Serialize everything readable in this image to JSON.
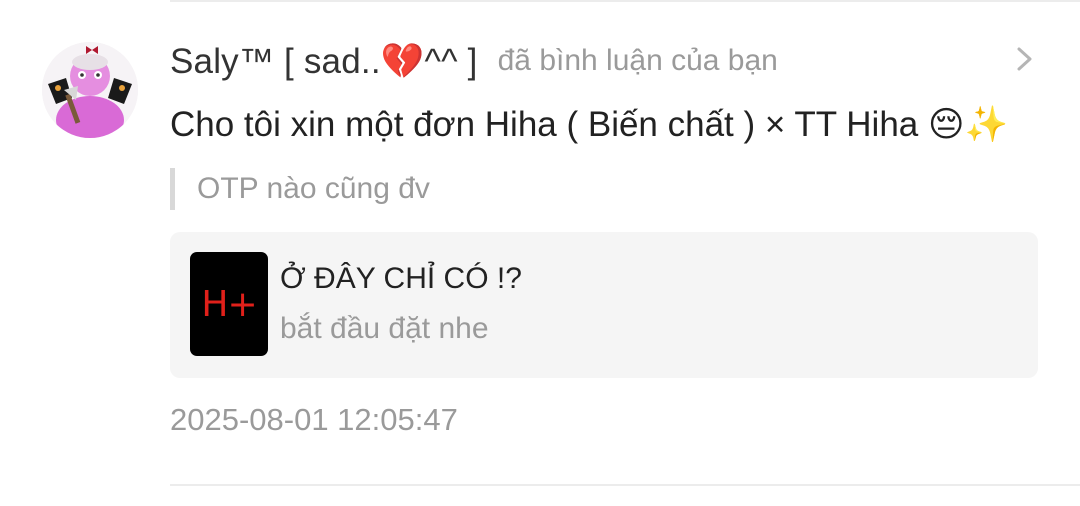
{
  "notification": {
    "username": "Saly™ [ sad..💔^^ ]",
    "action_text": "đã bình luận của bạn",
    "comment_text": "Cho tôi xin một đơn Hiha ( Biến chất ) × TT Hiha 😔✨",
    "quoted_text": "OTP nào cũng đv",
    "timestamp": "2025-08-01 12:05:47"
  },
  "post_card": {
    "thumbnail_text": "H+",
    "title": "Ở ĐÂY CHỈ CÓ !?",
    "subtitle": "bắt đầu đặt nhe"
  },
  "icons": {
    "avatar": "avatar-image",
    "chevron": "chevron-right-icon"
  },
  "colors": {
    "thumbnail_bg": "#000000",
    "thumbnail_text": "#e0201a",
    "secondary_text": "#9a9a9a",
    "card_bg": "#f5f5f5"
  }
}
